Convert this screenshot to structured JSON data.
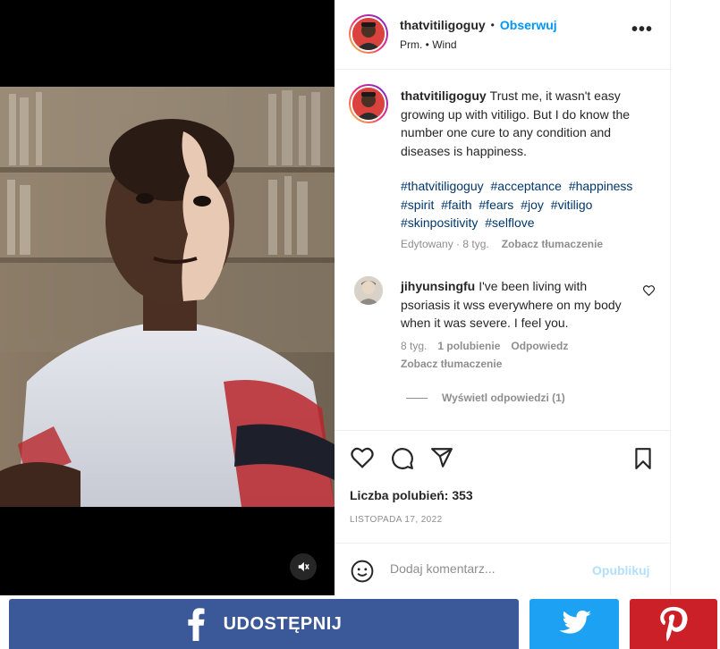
{
  "post": {
    "username": "thatvitiligoguy",
    "follow_label": "Obserwuj",
    "separator": "•",
    "subtitle": "Prm. • Wind",
    "more_label": "•••",
    "caption": "Trust me, it wasn't easy growing up with vitiligo. But I do know the number one cure to any condition and diseases is happiness.",
    "hashtags": [
      "#thatvitiligoguy",
      "#acceptance",
      "#happiness",
      "#spirit",
      "#faith",
      "#fears",
      "#joy",
      "#vitiligo",
      "#skinpositivity",
      "#selflove"
    ],
    "edited": "Edytowany · 8 tyg.",
    "see_translation": "Zobacz tłumaczenie",
    "likes": "Liczba polubień: 353",
    "date": "LISTOPADA 17, 2022",
    "comment_placeholder": "Dodaj komentarz...",
    "publish_label": "Opublikuj"
  },
  "comment": {
    "username": "jihyunsingfu",
    "text": "I've been living with psoriasis it wss everywhere on my body when it was severe. I feel you.",
    "age": "8 tyg.",
    "likes": "1 polubienie",
    "reply": "Odpowiedz",
    "see_translation": "Zobacz tłumaczenie",
    "view_replies": "Wyświetl odpowiedzi (1)"
  },
  "share": {
    "facebook_label": "UDOSTĘPNIJ",
    "facebook_color": "#3b5998",
    "twitter_color": "#1da1f2",
    "pinterest_color": "#cb2027"
  },
  "icons": {
    "like": "heart-icon",
    "comment": "comment-bubble-icon",
    "share": "paper-plane-icon",
    "save": "bookmark-icon",
    "emoji": "smiley-icon",
    "mute": "speaker-muted-icon"
  }
}
